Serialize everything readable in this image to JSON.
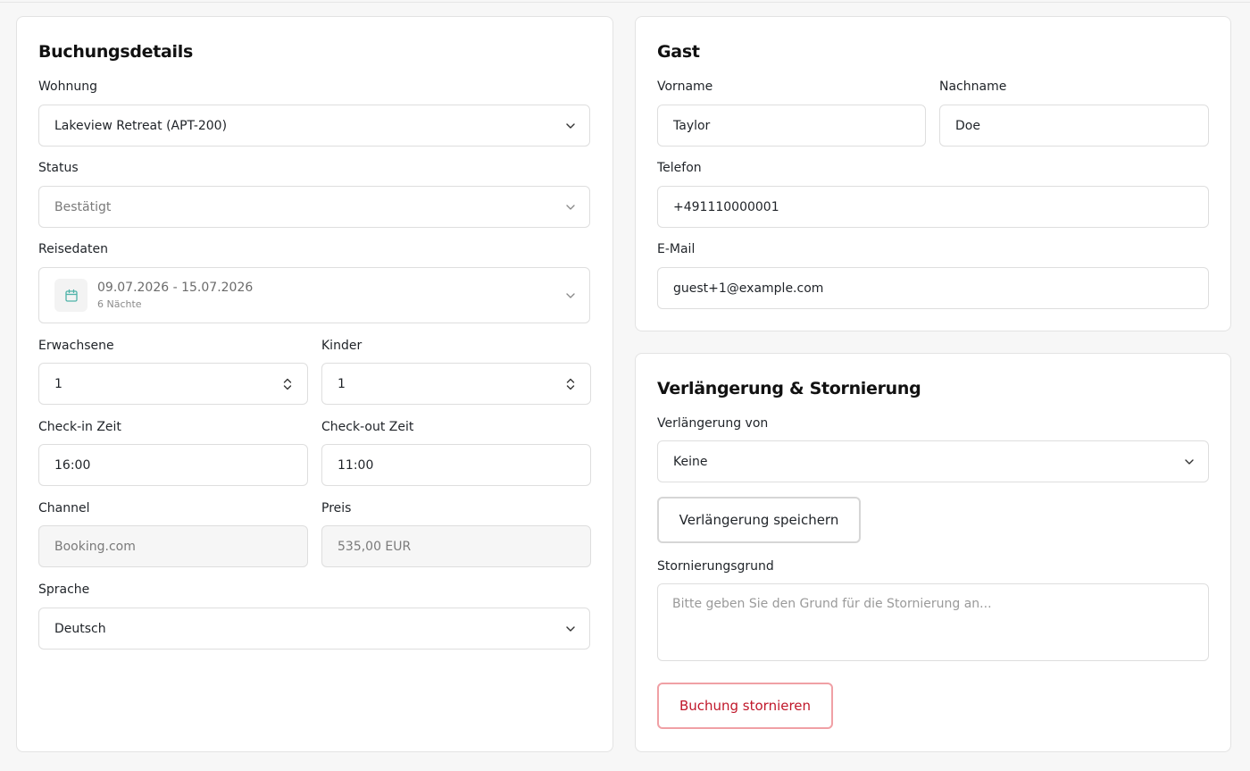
{
  "booking": {
    "title": "Buchungsdetails",
    "apartment_label": "Wohnung",
    "apartment_value": "Lakeview Retreat (APT-200)",
    "status_label": "Status",
    "status_value": "Bestätigt",
    "dates_label": "Reisedaten",
    "dates_range": "09.07.2026 - 15.07.2026",
    "dates_nights": "6 Nächte",
    "adults_label": "Erwachsene",
    "adults_value": "1",
    "children_label": "Kinder",
    "children_value": "1",
    "checkin_label": "Check-in Zeit",
    "checkin_value": "16:00",
    "checkout_label": "Check-out Zeit",
    "checkout_value": "11:00",
    "channel_label": "Channel",
    "channel_value": "Booking.com",
    "price_label": "Preis",
    "price_value": "535,00 EUR",
    "language_label": "Sprache",
    "language_value": "Deutsch"
  },
  "guest": {
    "title": "Gast",
    "firstname_label": "Vorname",
    "firstname_value": "Taylor",
    "lastname_label": "Nachname",
    "lastname_value": "Doe",
    "phone_label": "Telefon",
    "phone_value": "+491110000001",
    "email_label": "E-Mail",
    "email_value": "guest+1@example.com"
  },
  "extension": {
    "title": "Verlängerung & Stornierung",
    "extension_of_label": "Verlängerung von",
    "extension_of_value": "Keine",
    "save_button": "Verlängerung speichern",
    "cancel_reason_label": "Stornierungsgrund",
    "cancel_reason_placeholder": "Bitte geben Sie den Grund für die Stornierung an...",
    "cancel_button": "Buchung stornieren"
  },
  "colors": {
    "accent_teal": "#4fb3a9",
    "danger": "#c0172a",
    "danger_border": "#f0a0a5"
  }
}
